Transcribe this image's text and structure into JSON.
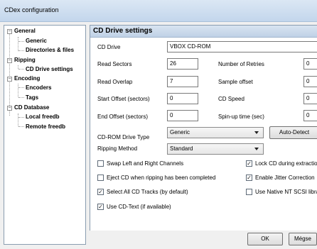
{
  "window": {
    "title": "CDex configuration"
  },
  "tree": {
    "general": "General",
    "generic": "Generic",
    "directories": "Directories & files",
    "ripping": "Ripping",
    "cd_drive_settings": "CD Drive settings",
    "encoding": "Encoding",
    "encoders": "Encoders",
    "tags": "Tags",
    "cd_database": "CD Database",
    "local_freedb": "Local freedb",
    "remote_freedb": "Remote freedb"
  },
  "panel": {
    "title": "CD Drive settings",
    "cd_drive_label": "CD Drive",
    "cd_drive_value": "VBOX   CD-ROM",
    "read_sectors_label": "Read Sectors",
    "read_sectors_value": "26",
    "read_overlap_label": "Read Overlap",
    "read_overlap_value": "7",
    "start_offset_label": "Start Offset (sectors)",
    "start_offset_value": "0",
    "end_offset_label": "End Offset (sectors)",
    "end_offset_value": "0",
    "retries_label": "Number of Retries",
    "retries_value": "0",
    "sample_offset_label": "Sample offset",
    "sample_offset_value": "0",
    "cd_speed_label": "CD Speed",
    "cd_speed_value": "0",
    "spinup_label": "Spin-up time (sec)",
    "spinup_value": "0",
    "drive_type_label": "CD-ROM Drive Type",
    "drive_type_value": "Generic",
    "auto_detect_label": "Auto-Detect",
    "ripping_method_label": "Ripping Method",
    "ripping_method_value": "Standard",
    "checkboxes": [
      {
        "label": "Swap Left and Right Channels",
        "checked": false
      },
      {
        "label": "Eject CD when ripping has been completed",
        "checked": false
      },
      {
        "label": "Select All CD Tracks (by default)",
        "checked": true
      },
      {
        "label": "Use CD-Text (if available)",
        "checked": true
      },
      {
        "label": "Lock CD during extraction",
        "checked": true
      },
      {
        "label": "Enable Jitter Correction",
        "checked": true
      },
      {
        "label": "Use Native NT SCSI library",
        "checked": false
      }
    ]
  },
  "footer": {
    "ok_label": "OK",
    "cancel_label": "Mégse"
  }
}
